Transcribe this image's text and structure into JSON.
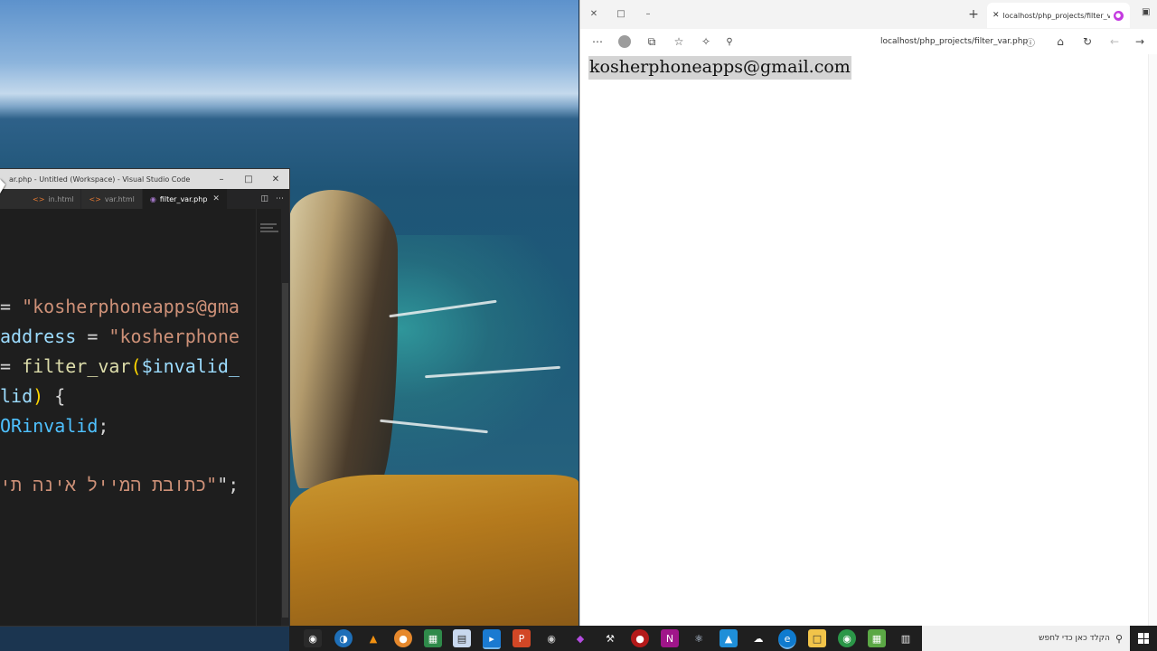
{
  "vscode": {
    "title": "ar.php - Untitled (Workspace) - Visual Studio Code",
    "tabs": [
      {
        "label": "in.html",
        "active": false
      },
      {
        "label": "var.html",
        "active": false
      },
      {
        "label": "filter_var.php",
        "active": true
      }
    ],
    "code": {
      "line1": {
        "op": "= ",
        "str": "\"kosherphoneapps@gma"
      },
      "line2": {
        "var": "address",
        "op": " = ",
        "str": "\"kosherphone"
      },
      "line3": {
        "op": "= ",
        "fn": "filter_var",
        "paren": "(",
        "var": "$invalid_"
      },
      "line4": {
        "var": "lid",
        "paren": ")",
        "op": " {"
      },
      "line5": {
        "const": "ORinvalid",
        "op": ";"
      },
      "line6": {
        "str": "\"כתובת המייל אינה תי",
        "op": "\";"
      }
    }
  },
  "browser": {
    "tab_label": "localhost/php_projects/filter_var",
    "url": "localhost/php_projects/filter_var.php",
    "content_text": "kosherphoneapps@gmail.com"
  },
  "taskbar": {
    "search_placeholder": "הקלד כאן כדי לחפש"
  },
  "colors": {
    "editor_bg": "#1e1e1e",
    "string": "#ce9178",
    "variable": "#9cdcfe",
    "function": "#dcdcaa",
    "selection_bg": "#d4d4d4",
    "taskbar_bg": "#1f1f1f"
  }
}
